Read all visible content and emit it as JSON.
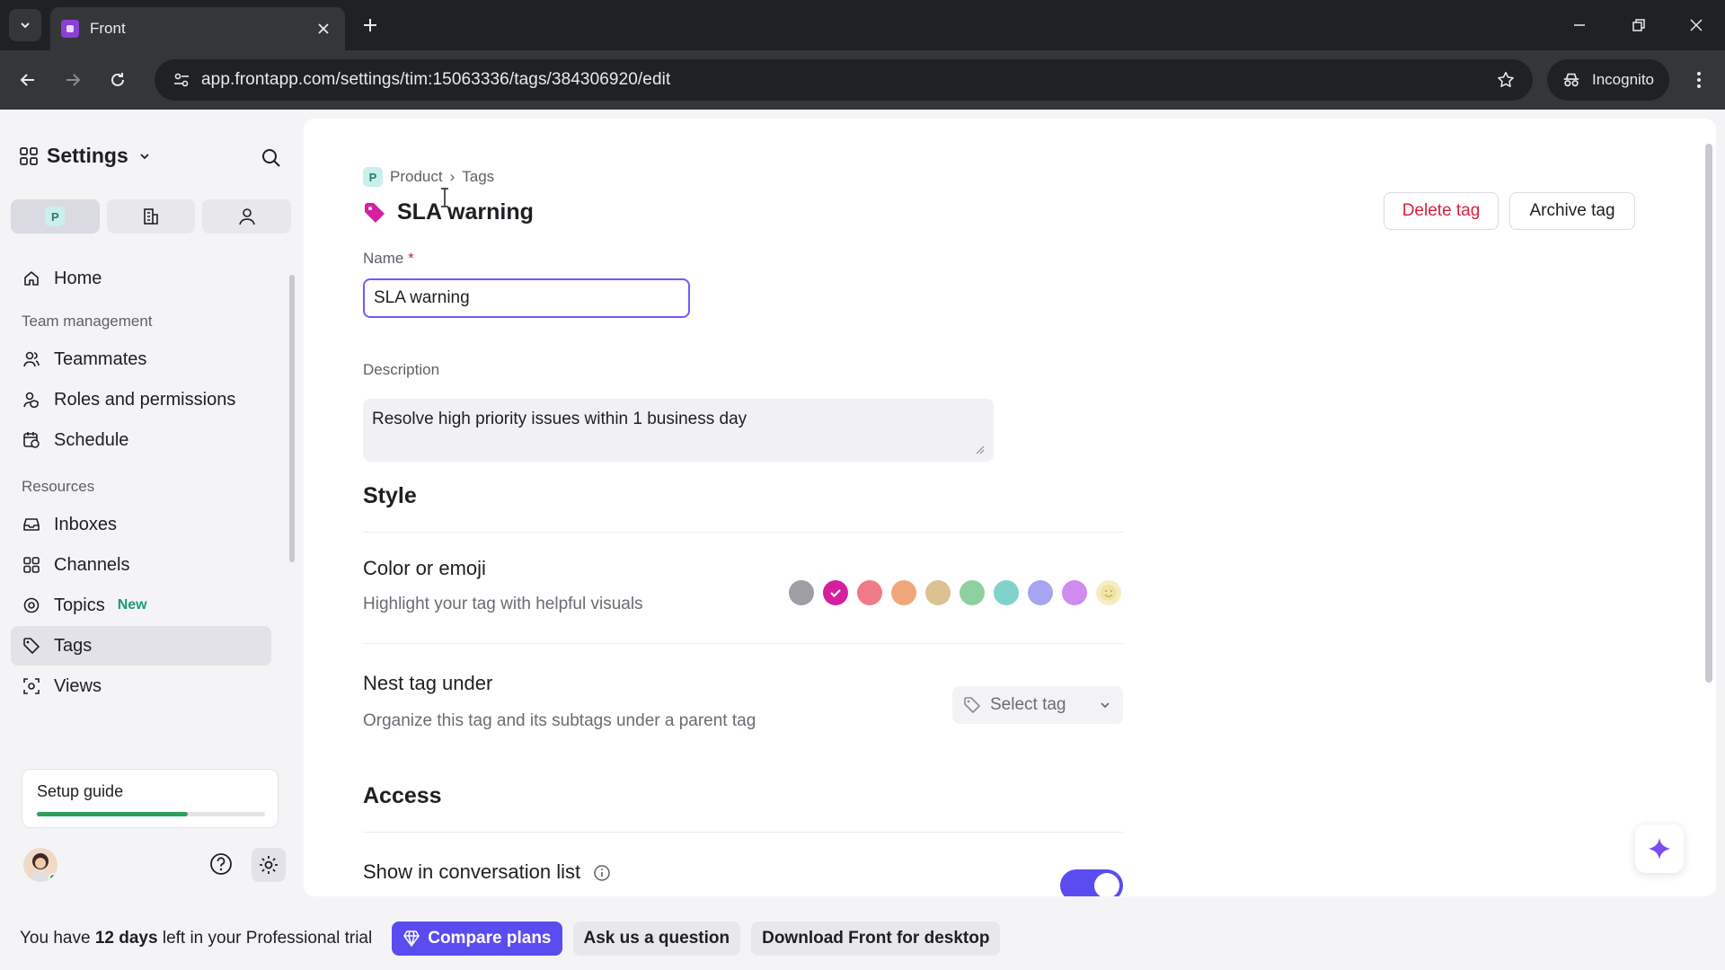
{
  "browser": {
    "tab_title": "Front",
    "url": "app.frontapp.com/settings/tim:15063336/tags/384306920/edit",
    "incognito_label": "Incognito"
  },
  "sidebar": {
    "title": "Settings",
    "switcher_badge": "P",
    "items": {
      "home": "Home",
      "team_section": "Team management",
      "teammates": "Teammates",
      "roles": "Roles and permissions",
      "schedule": "Schedule",
      "resources_section": "Resources",
      "inboxes": "Inboxes",
      "channels": "Channels",
      "topics": "Topics",
      "topics_badge": "New",
      "tags": "Tags",
      "views": "Views"
    },
    "setup_guide": {
      "label": "Setup guide",
      "progress": 0.66
    }
  },
  "main": {
    "breadcrumb": {
      "badge": "P",
      "workspace": "Product",
      "separator": "›",
      "section": "Tags"
    },
    "title": "SLA warning",
    "delete_label": "Delete tag",
    "archive_label": "Archive tag",
    "name_label": "Name",
    "required_mark": "*",
    "name_value": "SLA warning",
    "description_label": "Description",
    "description_value": "Resolve high priority issues within 1 business day",
    "style_heading": "Style",
    "color_title": "Color or emoji",
    "color_subtitle": "Highlight your tag with helpful visuals",
    "colors": [
      "#9e9ea4",
      "#d61f9e",
      "#f07a86",
      "#f2a67c",
      "#dcc192",
      "#8fd19e",
      "#7fd3cb",
      "#a7a4f2",
      "#cf8bef"
    ],
    "selected_color": "#d61f9e",
    "nest_title": "Nest tag under",
    "nest_subtitle": "Organize this tag and its subtags under a parent tag",
    "select_placeholder": "Select tag",
    "access_heading": "Access",
    "show_in_list_label": "Show in conversation list",
    "show_in_list_enabled": true
  },
  "trial": {
    "prefix": "You have ",
    "days": "12 days",
    "suffix": " left in your Professional trial",
    "compare_label": "Compare plans",
    "ask_label": "Ask us a question",
    "download_label": "Download Front for desktop"
  }
}
